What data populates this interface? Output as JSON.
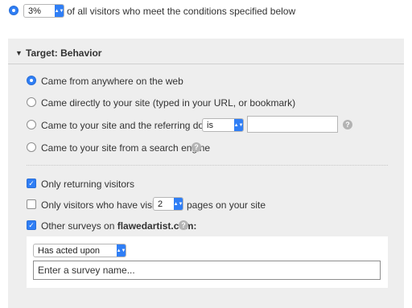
{
  "top": {
    "percent_value": "3%",
    "percent_suffix": "of all visitors who meet the conditions specified below"
  },
  "target": {
    "header": "Target: Behavior",
    "source_options": [
      "Came from anywhere on the web",
      "Came directly to your site (typed in your URL, or bookmark)",
      "Came to your site and the referring domain",
      "Came to your site from a search engine"
    ],
    "selected_source_index": 0,
    "referring_operator": "is",
    "referring_domain_value": ""
  },
  "visitors": {
    "returning_label": "Only returning visitors",
    "returning_checked": true,
    "visited_prefix": "Only visitors who have visited",
    "visited_count": "2",
    "visited_suffix": "pages on your site",
    "visited_checked": false,
    "other_surveys_prefix": "Other surveys on",
    "other_surveys_site": "flawedartist.com:",
    "other_surveys_checked": true
  },
  "survey": {
    "action": "Has acted upon",
    "name_placeholder": "Enter a survey name..."
  },
  "help_symbol": "?",
  "icons": {
    "collapse": "triangle-down-icon",
    "help": "help-icon",
    "select_arrow": "updown-chevron-icon"
  },
  "colors": {
    "accent": "#2f7ef5",
    "panel_bg": "#eeeeee"
  }
}
